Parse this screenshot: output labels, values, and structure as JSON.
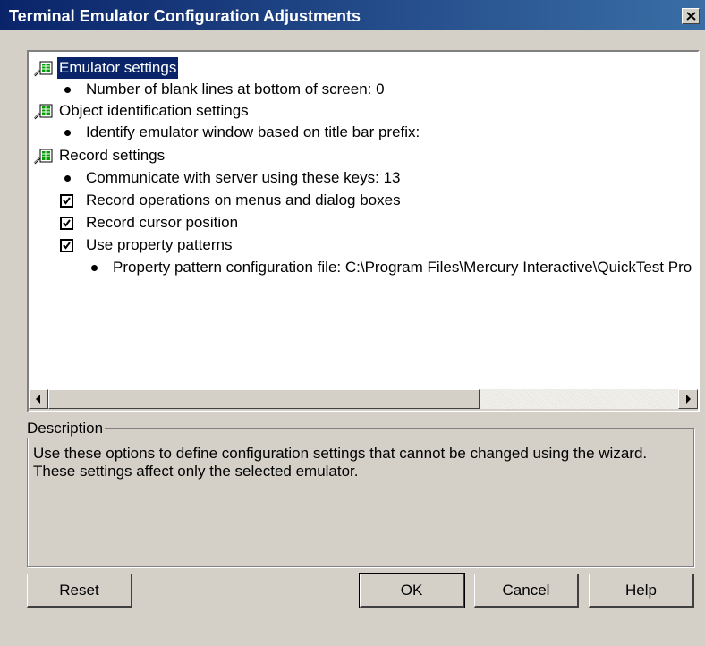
{
  "window": {
    "title": "Terminal Emulator Configuration Adjustments"
  },
  "tree": {
    "categories": [
      {
        "label": "Emulator settings",
        "selected": true,
        "items": [
          {
            "type": "bullet",
            "label": "Number of blank lines at bottom of screen: 0"
          }
        ]
      },
      {
        "label": "Object identification settings",
        "items": [
          {
            "type": "bullet",
            "label": "Identify emulator window based on title bar prefix:"
          }
        ]
      },
      {
        "label": "Record settings",
        "items": [
          {
            "type": "bullet",
            "label": "Communicate with server using these keys: 13"
          },
          {
            "type": "checkbox",
            "checked": true,
            "label": "Record operations on menus and dialog boxes"
          },
          {
            "type": "checkbox",
            "checked": true,
            "label": "Record cursor position"
          },
          {
            "type": "checkbox",
            "checked": true,
            "label": "Use property patterns"
          },
          {
            "type": "subbullet",
            "label": "Property pattern configuration file: C:\\Program Files\\Mercury Interactive\\QuickTest Pro"
          }
        ]
      }
    ]
  },
  "description": {
    "legend": "Description",
    "text_line1": "Use these options to define configuration settings that cannot be changed using the wizard.",
    "text_line2": "These settings affect only the selected emulator."
  },
  "buttons": {
    "reset": "Reset",
    "ok": "OK",
    "cancel": "Cancel",
    "help": "Help"
  },
  "icons": {
    "category": "settings-category-icon",
    "close": "close-icon",
    "scroll_left": "arrow-left-icon",
    "scroll_right": "arrow-right-icon"
  },
  "colors": {
    "title_bar_start": "#0a246a",
    "title_bar_end": "#3a6ea5",
    "selection": "#0a246a",
    "dialog_bg": "#d4d0c8"
  }
}
